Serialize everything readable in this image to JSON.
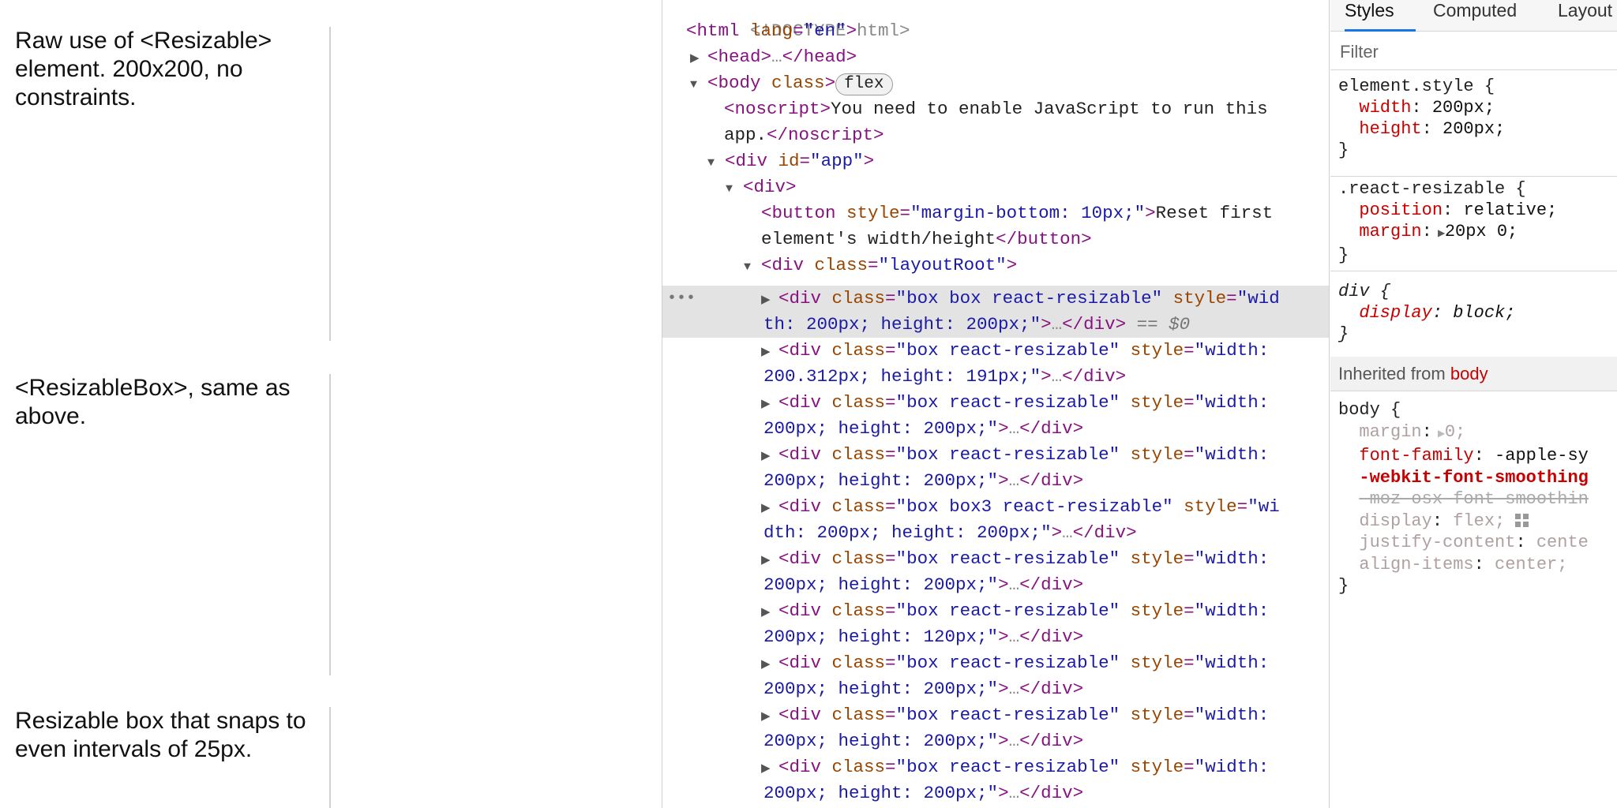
{
  "page": {
    "blocks": [
      {
        "text": "Raw use of <Resizable>\nelement. 200x200, no\nconstraints."
      },
      {
        "text": "<ResizableBox>, same as\nabove."
      },
      {
        "text": "Resizable box that snaps to\neven intervals of 25px."
      }
    ]
  },
  "elements": {
    "doctype": "<!DOCTYPE html>",
    "html_tag": "html",
    "html_attr": "lang",
    "html_val": "en",
    "head": "head",
    "body_tag": "body",
    "body_class_attr": "class",
    "body_class_val": "",
    "flex_badge": "flex",
    "noscript_text_1": "You need to enable JavaScript to run this",
    "noscript_text_2": "app.",
    "div_id_attr": "id",
    "div_id_val": "app",
    "button_style_val": "margin-bottom: 10px;",
    "button_text_1": "Reset first",
    "button_text_2": "element's width/height",
    "layout_root_class": "layoutRoot",
    "selected_ref": "== $0",
    "nodes": [
      {
        "cls": "box box react-resizable",
        "style1": "wid",
        "style2": "th: 200px; height: 200px;"
      },
      {
        "cls": "box react-resizable",
        "style1": "width:",
        "style2": "200.312px; height: 191px;"
      },
      {
        "cls": "box react-resizable",
        "style1": "width:",
        "style2": "200px; height: 200px;"
      },
      {
        "cls": "box react-resizable",
        "style1": "width:",
        "style2": "200px; height: 200px;"
      },
      {
        "cls": "box box3 react-resizable",
        "style1": "wi",
        "style2": "dth: 200px; height: 200px;"
      },
      {
        "cls": "box react-resizable",
        "style1": "width:",
        "style2": "200px; height: 200px;"
      },
      {
        "cls": "box react-resizable",
        "style1": "width:",
        "style2": "200px; height: 120px;"
      },
      {
        "cls": "box react-resizable",
        "style1": "width:",
        "style2": "200px; height: 200px;"
      },
      {
        "cls": "box react-resizable",
        "style1": "width:",
        "style2": "200px; height: 200px;"
      },
      {
        "cls": "box react-resizable",
        "style1": "width:",
        "style2": "200px; height: 200px;"
      }
    ]
  },
  "styles": {
    "tabs": [
      "Styles",
      "Computed",
      "Layout"
    ],
    "filter_placeholder": "Filter",
    "element_style": {
      "selector": "element.style {",
      "decls": [
        {
          "p": "width",
          "v": "200px;"
        },
        {
          "p": "height",
          "v": "200px;"
        }
      ]
    },
    "react_resizable": {
      "selector": ".react-resizable {",
      "decls": [
        {
          "p": "position",
          "v": "relative;"
        },
        {
          "p": "margin",
          "v": "20px 0;"
        }
      ]
    },
    "div_rule": {
      "selector": "div {",
      "decls": [
        {
          "p": "display",
          "v": "block;"
        }
      ]
    },
    "inherited_label": "Inherited from",
    "inherited_from": "body",
    "body_rule": {
      "selector": "body {",
      "decls": [
        {
          "p": "margin",
          "v": "0;"
        },
        {
          "p": "font-family",
          "v": "-apple-sy"
        },
        {
          "p": "-webkit-font-smoothing",
          "v": ""
        },
        {
          "p": "-moz-osx-font-smoothin",
          "v": ""
        },
        {
          "p": "display",
          "v": "flex;"
        },
        {
          "p": "justify-content",
          "v": "cente"
        },
        {
          "p": "align-items",
          "v": "center;"
        }
      ]
    },
    "close_brace": "}"
  }
}
